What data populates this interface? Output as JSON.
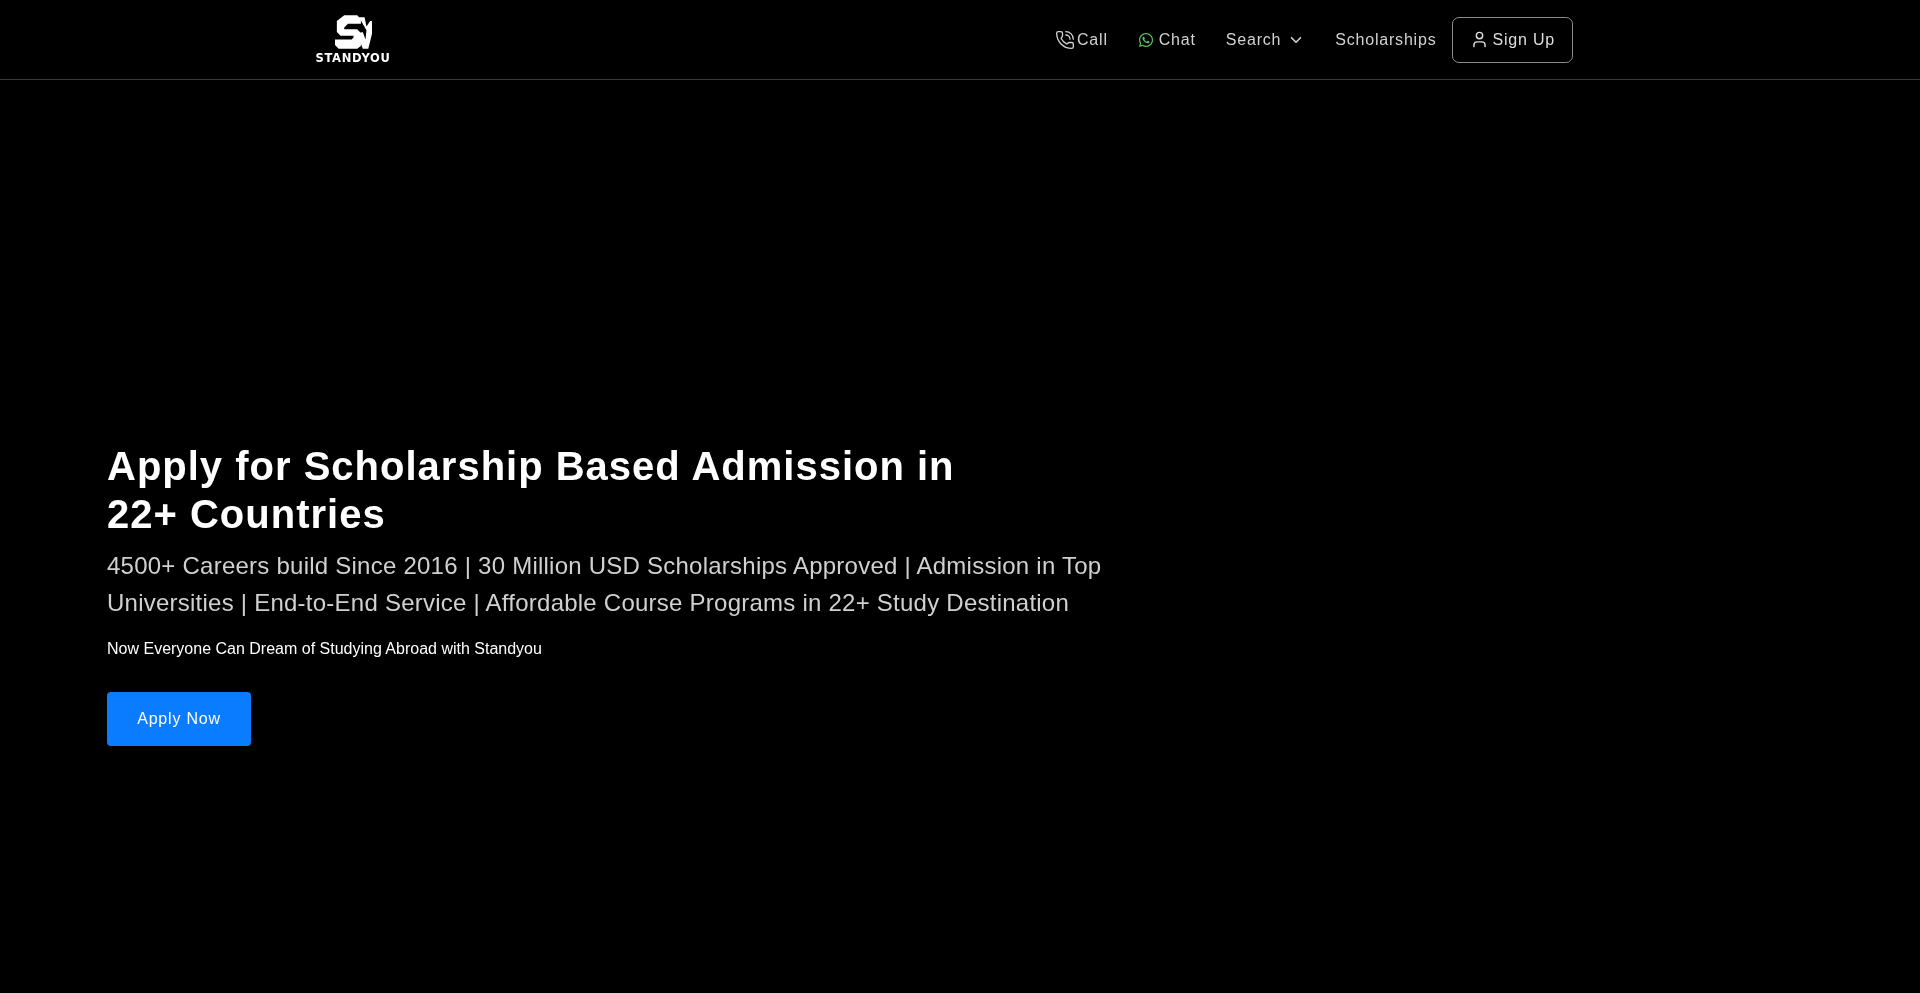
{
  "header": {
    "logo": {
      "wordmark": "STANDYOU"
    },
    "nav": [
      {
        "kind": "call",
        "label": "Call"
      },
      {
        "kind": "chat",
        "label": "Chat"
      },
      {
        "kind": "dropdown",
        "label": "Search"
      },
      {
        "kind": "link",
        "label": "Scholarships"
      },
      {
        "kind": "account",
        "label": "Sign Up"
      }
    ]
  },
  "hero": {
    "title": "Apply for Scholarship Based Admission in 22+ Countries",
    "subtitle": "4500+ Careers build Since 2016 | 30 Million USD Scholarships Approved | Admission in Top Universities | End-to-End Service | Affordable Course Programs in 22+ Study Destination",
    "tagline": "Now Everyone Can Dream of Studying Abroad with Standyou",
    "button": "Apply Now"
  }
}
